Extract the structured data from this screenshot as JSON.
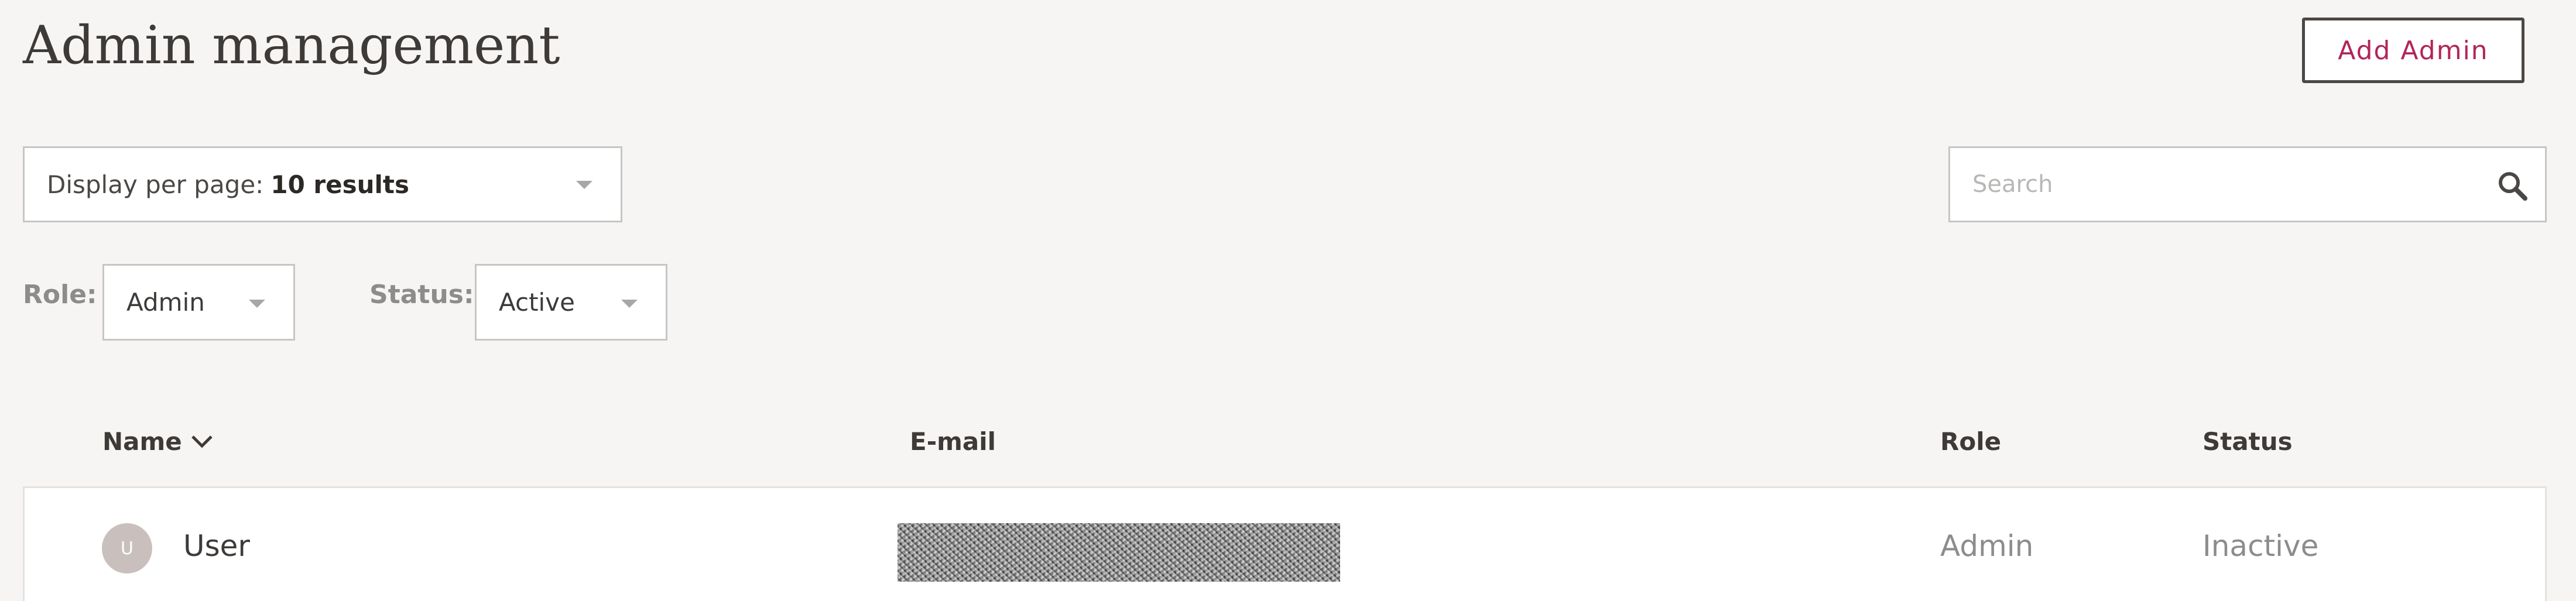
{
  "header": {
    "title": "Admin management",
    "add_button_label": "Add Admin"
  },
  "controls": {
    "per_page_label": "Display per page:",
    "per_page_value": "10 results",
    "search_placeholder": "Search",
    "search_value": ""
  },
  "filters": {
    "role_label": "Role:",
    "role_value": "Admin",
    "status_label": "Status:",
    "status_value": "Active"
  },
  "table": {
    "columns": {
      "name": "Name",
      "email": "E-mail",
      "role": "Role",
      "status": "Status"
    },
    "rows": [
      {
        "initial": "U",
        "name": "User",
        "role": "Admin",
        "status": "Inactive"
      }
    ]
  },
  "colors": {
    "background": "#f7f5f3",
    "accent": "#b3245a",
    "muted_text": "#8e8c8a"
  },
  "icons": {
    "search": "search-icon",
    "sort": "chevron-down-icon",
    "dropdown": "caret-down-icon"
  }
}
